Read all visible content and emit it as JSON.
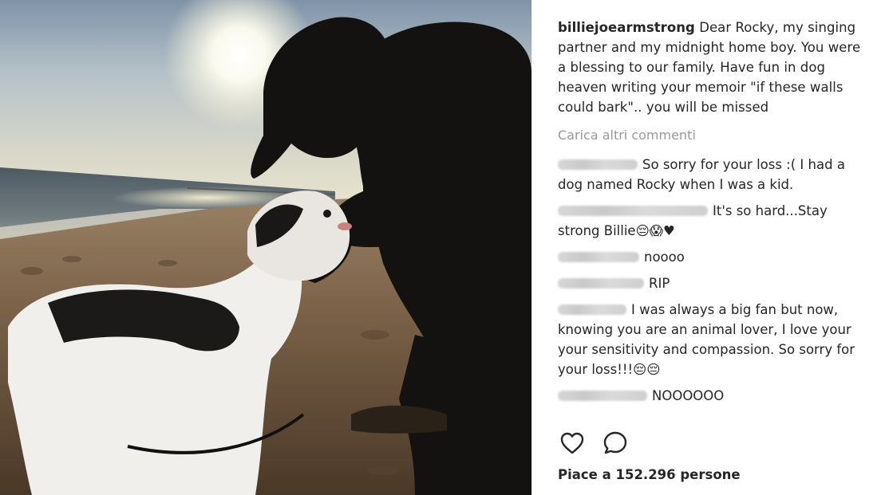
{
  "post": {
    "author": "billiejoearmstrong",
    "caption": "Dear Rocky, my singing partner and my midnight home boy. You were a blessing to our family. Have fun in dog heaven writing your memoir \"if these walls could bark\".. you will be missed",
    "load_more_label": "Carica altri commenti",
    "likes_label": "Piace a 152.296 persone"
  },
  "comments": [
    {
      "text": "So sorry for your loss :( I had a dog named Rocky when I was a kid."
    },
    {
      "text": "It's so hard...Stay strong Billie😔😱♥"
    },
    {
      "text": "noooo"
    },
    {
      "text": "RIP"
    },
    {
      "text": "I was always a big fan but now, knowing you are an animal lover, I love your your sensitivity and compassion. So sorry for your loss!!!😔😔"
    },
    {
      "text": "NOOOOOO"
    }
  ],
  "icons": {
    "like": "heart-outline-icon",
    "comment": "speech-bubble-icon"
  },
  "colors": {
    "text": "#262626",
    "muted": "#999999"
  }
}
